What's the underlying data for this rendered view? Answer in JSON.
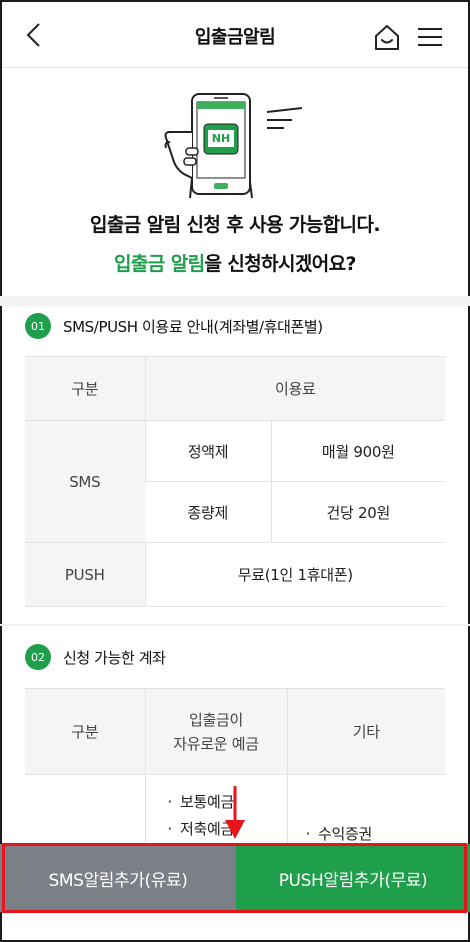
{
  "header": {
    "title": "입출금알림",
    "back_icon": "chevron-left-icon",
    "home_icon": "home-icon",
    "menu_icon": "hamburger-menu-icon"
  },
  "intro": {
    "logo_text": "NH",
    "line1": "입출금 알림 신청 후 사용 가능합니다.",
    "line2_accent": "입출금 알림",
    "line2_rest": "을 신청하시겠어요?"
  },
  "section1": {
    "number": "01",
    "title": "SMS/PUSH 이용료 안내(계좌별/휴대폰별)",
    "header": {
      "col1": "구분",
      "col2": "이용료"
    },
    "sms_label": "SMS",
    "rows": [
      {
        "plan": "정액제",
        "price": "매월 900원"
      },
      {
        "plan": "종량제",
        "price": "건당 20원"
      }
    ],
    "push_label": "PUSH",
    "push_price": "무료(1인 1휴대폰)"
  },
  "section2": {
    "number": "02",
    "title": "신청 가능한 계좌",
    "header": {
      "col1": "구분",
      "col2_line1": "입출금이",
      "col2_line2": "자유로운 예금",
      "col3": "기타"
    },
    "col2_items": [
      "보통예금",
      "저축예금"
    ],
    "col3_items": [
      "수익증권"
    ]
  },
  "buttons": {
    "sms": "SMS알림추가(유료)",
    "push": "PUSH알림추가(무료)"
  },
  "colors": {
    "accent_green": "#1f9e4b",
    "sms_button_gray": "#7b7f86",
    "highlight_red": "#e8131b"
  }
}
